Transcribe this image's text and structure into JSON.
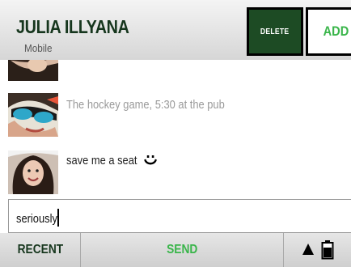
{
  "header": {
    "contact_name": "JULIA ILLYANA",
    "contact_type": "Mobile",
    "delete_label": "DELETE",
    "add_label": "ADD"
  },
  "messages": [
    {
      "text": ""
    },
    {
      "text": "The hockey game, 5:30 at the pub"
    },
    {
      "text": "save me a seat",
      "emoji": "smile-icon"
    }
  ],
  "compose": {
    "value": "seriously"
  },
  "bottom_bar": {
    "recent_label": "RECENT",
    "send_label": "SEND"
  },
  "colors": {
    "brand_dark_green": "#1d4b24",
    "accent_green": "#39b54a",
    "header_text": "#16361d"
  }
}
